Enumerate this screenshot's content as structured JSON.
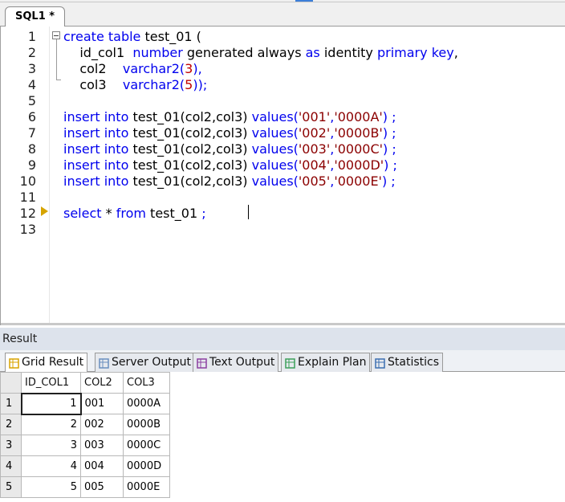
{
  "editor_tab": {
    "label": "SQL1 *"
  },
  "editor": {
    "line_numbers": [
      "1",
      "2",
      "3",
      "4",
      "5",
      "6",
      "7",
      "8",
      "9",
      "10",
      "11",
      "12",
      "13"
    ],
    "lines": [
      [
        {
          "t": "create table",
          "c": "kw"
        },
        {
          "t": " test_01 (",
          "c": ""
        }
      ],
      [
        {
          "t": "    id_col1  ",
          "c": ""
        },
        {
          "t": "number",
          "c": "kw"
        },
        {
          "t": " generated always ",
          "c": ""
        },
        {
          "t": "as",
          "c": "kw"
        },
        {
          "t": " identity ",
          "c": ""
        },
        {
          "t": "primary key",
          "c": "kw"
        },
        {
          "t": ",",
          "c": ""
        }
      ],
      [
        {
          "t": "    col2    ",
          "c": ""
        },
        {
          "t": "varchar2(",
          "c": "kw"
        },
        {
          "t": "3",
          "c": "num"
        },
        {
          "t": "),",
          "c": "kw"
        }
      ],
      [
        {
          "t": "    col3    ",
          "c": ""
        },
        {
          "t": "varchar2(",
          "c": "kw"
        },
        {
          "t": "5",
          "c": "num"
        },
        {
          "t": "));",
          "c": "kw"
        }
      ],
      [],
      [
        {
          "t": "insert into",
          "c": "kw"
        },
        {
          "t": " test_01(col2,col3) ",
          "c": ""
        },
        {
          "t": "values(",
          "c": "kw"
        },
        {
          "t": "'001'",
          "c": "str"
        },
        {
          "t": ",",
          "c": "kw"
        },
        {
          "t": "'0000A'",
          "c": "str"
        },
        {
          "t": ") ;",
          "c": "kw"
        }
      ],
      [
        {
          "t": "insert into",
          "c": "kw"
        },
        {
          "t": " test_01(col2,col3) ",
          "c": ""
        },
        {
          "t": "values(",
          "c": "kw"
        },
        {
          "t": "'002'",
          "c": "str"
        },
        {
          "t": ",",
          "c": "kw"
        },
        {
          "t": "'0000B'",
          "c": "str"
        },
        {
          "t": ") ;",
          "c": "kw"
        }
      ],
      [
        {
          "t": "insert into",
          "c": "kw"
        },
        {
          "t": " test_01(col2,col3) ",
          "c": ""
        },
        {
          "t": "values(",
          "c": "kw"
        },
        {
          "t": "'003'",
          "c": "str"
        },
        {
          "t": ",",
          "c": "kw"
        },
        {
          "t": "'0000C'",
          "c": "str"
        },
        {
          "t": ") ;",
          "c": "kw"
        }
      ],
      [
        {
          "t": "insert into",
          "c": "kw"
        },
        {
          "t": " test_01(col2,col3) ",
          "c": ""
        },
        {
          "t": "values(",
          "c": "kw"
        },
        {
          "t": "'004'",
          "c": "str"
        },
        {
          "t": ",",
          "c": "kw"
        },
        {
          "t": "'0000D'",
          "c": "str"
        },
        {
          "t": ") ;",
          "c": "kw"
        }
      ],
      [
        {
          "t": "insert into",
          "c": "kw"
        },
        {
          "t": " test_01(col2,col3) ",
          "c": ""
        },
        {
          "t": "values(",
          "c": "kw"
        },
        {
          "t": "'005'",
          "c": "str"
        },
        {
          "t": ",",
          "c": "kw"
        },
        {
          "t": "'0000E'",
          "c": "str"
        },
        {
          "t": ") ;",
          "c": "kw"
        }
      ],
      [],
      [
        {
          "t": "select",
          "c": "kw"
        },
        {
          "t": " * ",
          "c": ""
        },
        {
          "t": "from",
          "c": "kw"
        },
        {
          "t": " test_01 ",
          "c": ""
        },
        {
          "t": ";",
          "c": "kw"
        }
      ],
      []
    ]
  },
  "result": {
    "header": "Result",
    "tabs": [
      {
        "label": "Grid Result",
        "icon": "grid-icon"
      },
      {
        "label": "Server Output",
        "icon": "server-output-icon"
      },
      {
        "label": "Text Output",
        "icon": "text-output-icon"
      },
      {
        "label": "Explain Plan",
        "icon": "explain-plan-icon"
      },
      {
        "label": "Statistics",
        "icon": "statistics-icon"
      }
    ],
    "columns": [
      "ID_COL1",
      "COL2",
      "COL3"
    ],
    "rows": [
      {
        "n": "1",
        "id": "1",
        "col2": "001",
        "col3": "0000A"
      },
      {
        "n": "2",
        "id": "2",
        "col2": "002",
        "col3": "0000B"
      },
      {
        "n": "3",
        "id": "3",
        "col2": "003",
        "col3": "0000C"
      },
      {
        "n": "4",
        "id": "4",
        "col2": "004",
        "col3": "0000D"
      },
      {
        "n": "5",
        "id": "5",
        "col2": "005",
        "col3": "0000E"
      }
    ]
  },
  "colors": {
    "keyword": "#0000ee",
    "number": "#c00000",
    "string": "#8b0000",
    "result_header_bg": "#dde3ec"
  }
}
